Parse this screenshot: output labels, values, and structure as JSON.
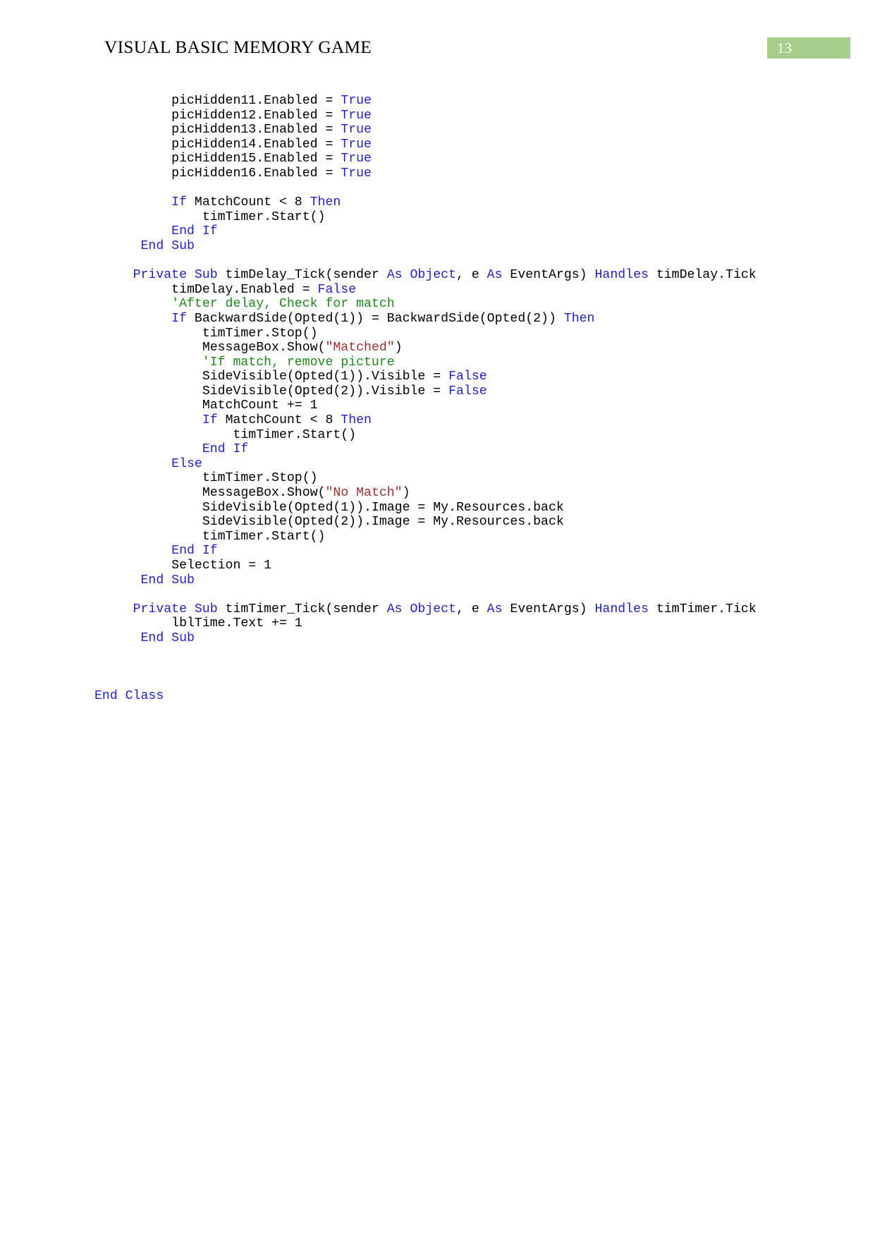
{
  "header": {
    "title": "VISUAL BASIC MEMORY GAME",
    "page_number": "13",
    "badge_color": "#A8CE8E",
    "badge_text_color": "#FFFFFF"
  },
  "syntax_colors": {
    "keyword": "#2222CC",
    "string": "#A03030",
    "comment": "#1E8A1E",
    "plain": "#000000"
  },
  "code": {
    "language": "Visual Basic .NET",
    "lines": [
      {
        "indent": 10,
        "tokens": [
          {
            "t": "picHidden11.Enabled = ",
            "c": "pln"
          },
          {
            "t": "True",
            "c": "kw"
          }
        ]
      },
      {
        "indent": 10,
        "tokens": [
          {
            "t": "picHidden12.Enabled = ",
            "c": "pln"
          },
          {
            "t": "True",
            "c": "kw"
          }
        ]
      },
      {
        "indent": 10,
        "tokens": [
          {
            "t": "picHidden13.Enabled = ",
            "c": "pln"
          },
          {
            "t": "True",
            "c": "kw"
          }
        ]
      },
      {
        "indent": 10,
        "tokens": [
          {
            "t": "picHidden14.Enabled = ",
            "c": "pln"
          },
          {
            "t": "True",
            "c": "kw"
          }
        ]
      },
      {
        "indent": 10,
        "tokens": [
          {
            "t": "picHidden15.Enabled = ",
            "c": "pln"
          },
          {
            "t": "True",
            "c": "kw"
          }
        ]
      },
      {
        "indent": 10,
        "tokens": [
          {
            "t": "picHidden16.Enabled = ",
            "c": "pln"
          },
          {
            "t": "True",
            "c": "kw"
          }
        ]
      },
      {
        "indent": 0,
        "tokens": []
      },
      {
        "indent": 10,
        "tokens": [
          {
            "t": "If",
            "c": "kw"
          },
          {
            "t": " MatchCount < 8 ",
            "c": "pln"
          },
          {
            "t": "Then",
            "c": "kw"
          }
        ]
      },
      {
        "indent": 14,
        "tokens": [
          {
            "t": "timTimer.Start()",
            "c": "pln"
          }
        ]
      },
      {
        "indent": 10,
        "tokens": [
          {
            "t": "End If",
            "c": "kw"
          }
        ]
      },
      {
        "indent": 6,
        "tokens": [
          {
            "t": "End Sub",
            "c": "kw"
          }
        ]
      },
      {
        "indent": 0,
        "tokens": []
      },
      {
        "indent": 5,
        "tokens": [
          {
            "t": "Private Sub",
            "c": "kw"
          },
          {
            "t": " timDelay_Tick(sender ",
            "c": "pln"
          },
          {
            "t": "As Object",
            "c": "kw"
          },
          {
            "t": ", e ",
            "c": "pln"
          },
          {
            "t": "As",
            "c": "kw"
          },
          {
            "t": " EventArgs) ",
            "c": "pln"
          },
          {
            "t": "Handles",
            "c": "kw"
          },
          {
            "t": " timDelay.Tick",
            "c": "pln"
          }
        ]
      },
      {
        "indent": 10,
        "tokens": [
          {
            "t": "timDelay.Enabled = ",
            "c": "pln"
          },
          {
            "t": "False",
            "c": "kw"
          }
        ]
      },
      {
        "indent": 10,
        "tokens": [
          {
            "t": "'After delay, Check for match",
            "c": "cmt"
          }
        ]
      },
      {
        "indent": 10,
        "tokens": [
          {
            "t": "If",
            "c": "kw"
          },
          {
            "t": " BackwardSide(Opted(1)) = BackwardSide(Opted(2)) ",
            "c": "pln"
          },
          {
            "t": "Then",
            "c": "kw"
          }
        ]
      },
      {
        "indent": 14,
        "tokens": [
          {
            "t": "timTimer.Stop()",
            "c": "pln"
          }
        ]
      },
      {
        "indent": 14,
        "tokens": [
          {
            "t": "MessageBox.Show(",
            "c": "pln"
          },
          {
            "t": "\"Matched\"",
            "c": "str"
          },
          {
            "t": ")",
            "c": "pln"
          }
        ]
      },
      {
        "indent": 14,
        "tokens": [
          {
            "t": "'If match, remove picture",
            "c": "cmt"
          }
        ]
      },
      {
        "indent": 14,
        "tokens": [
          {
            "t": "SideVisible(Opted(1)).Visible = ",
            "c": "pln"
          },
          {
            "t": "False",
            "c": "kw"
          }
        ]
      },
      {
        "indent": 14,
        "tokens": [
          {
            "t": "SideVisible(Opted(2)).Visible = ",
            "c": "pln"
          },
          {
            "t": "False",
            "c": "kw"
          }
        ]
      },
      {
        "indent": 14,
        "tokens": [
          {
            "t": "MatchCount += 1",
            "c": "pln"
          }
        ]
      },
      {
        "indent": 14,
        "tokens": [
          {
            "t": "If",
            "c": "kw"
          },
          {
            "t": " MatchCount < 8 ",
            "c": "pln"
          },
          {
            "t": "Then",
            "c": "kw"
          }
        ]
      },
      {
        "indent": 18,
        "tokens": [
          {
            "t": "timTimer.Start()",
            "c": "pln"
          }
        ]
      },
      {
        "indent": 14,
        "tokens": [
          {
            "t": "End If",
            "c": "kw"
          }
        ]
      },
      {
        "indent": 10,
        "tokens": [
          {
            "t": "Else",
            "c": "kw"
          }
        ]
      },
      {
        "indent": 14,
        "tokens": [
          {
            "t": "timTimer.Stop()",
            "c": "pln"
          }
        ]
      },
      {
        "indent": 14,
        "tokens": [
          {
            "t": "MessageBox.Show(",
            "c": "pln"
          },
          {
            "t": "\"No Match\"",
            "c": "str"
          },
          {
            "t": ")",
            "c": "pln"
          }
        ]
      },
      {
        "indent": 14,
        "tokens": [
          {
            "t": "SideVisible(Opted(1)).Image = My.Resources.back",
            "c": "pln"
          }
        ]
      },
      {
        "indent": 14,
        "tokens": [
          {
            "t": "SideVisible(Opted(2)).Image = My.Resources.back",
            "c": "pln"
          }
        ]
      },
      {
        "indent": 14,
        "tokens": [
          {
            "t": "timTimer.Start()",
            "c": "pln"
          }
        ]
      },
      {
        "indent": 10,
        "tokens": [
          {
            "t": "End If",
            "c": "kw"
          }
        ]
      },
      {
        "indent": 10,
        "tokens": [
          {
            "t": "Selection = 1",
            "c": "pln"
          }
        ]
      },
      {
        "indent": 6,
        "tokens": [
          {
            "t": "End Sub",
            "c": "kw"
          }
        ]
      },
      {
        "indent": 0,
        "tokens": []
      },
      {
        "indent": 5,
        "tokens": [
          {
            "t": "Private Sub",
            "c": "kw"
          },
          {
            "t": " timTimer_Tick(sender ",
            "c": "pln"
          },
          {
            "t": "As Object",
            "c": "kw"
          },
          {
            "t": ", e ",
            "c": "pln"
          },
          {
            "t": "As",
            "c": "kw"
          },
          {
            "t": " EventArgs) ",
            "c": "pln"
          },
          {
            "t": "Handles",
            "c": "kw"
          },
          {
            "t": " timTimer.Tick",
            "c": "pln"
          }
        ]
      },
      {
        "indent": 10,
        "tokens": [
          {
            "t": "lblTime.Text += 1",
            "c": "pln"
          }
        ]
      },
      {
        "indent": 6,
        "tokens": [
          {
            "t": "End Sub",
            "c": "kw"
          }
        ]
      },
      {
        "indent": 0,
        "tokens": []
      },
      {
        "indent": 0,
        "tokens": []
      },
      {
        "indent": 0,
        "tokens": []
      },
      {
        "indent": 0,
        "tokens": [
          {
            "t": "End Class",
            "c": "kw"
          }
        ]
      }
    ]
  }
}
